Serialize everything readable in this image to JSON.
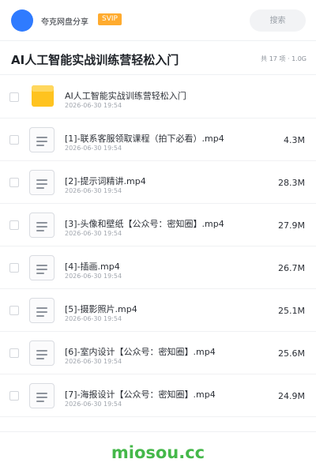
{
  "header": {
    "brand": "夸克网盘分享",
    "badge": "SVIP",
    "search_placeholder": "搜索"
  },
  "title_bar": {
    "title": "AI人工智能实战训练营轻松入门",
    "summary": "共 17 项 · 1.0G"
  },
  "files": [
    {
      "name": "AI人工智能实战训练营轻松入门",
      "date": "2026-06-30 19:54",
      "size": "",
      "type": "folder"
    },
    {
      "name": "[1]-联系客服领取课程（拍下必看）.mp4",
      "date": "2026-06-30 19:54",
      "size": "4.3M",
      "type": "file"
    },
    {
      "name": "[2]-提示词精讲.mp4",
      "date": "2026-06-30 19:54",
      "size": "28.3M",
      "type": "file"
    },
    {
      "name": "[3]-头像和壁纸【公众号：密知圈】.mp4",
      "date": "2026-06-30 19:54",
      "size": "27.9M",
      "type": "file"
    },
    {
      "name": "[4]-插画.mp4",
      "date": "2026-06-30 19:54",
      "size": "26.7M",
      "type": "file"
    },
    {
      "name": "[5]-摄影照片.mp4",
      "date": "2026-06-30 19:54",
      "size": "25.1M",
      "type": "file"
    },
    {
      "name": "[6]-室内设计【公众号：密知圈】.mp4",
      "date": "2026-06-30 19:54",
      "size": "25.6M",
      "type": "file"
    },
    {
      "name": "[7]-海报设计【公众号：密知圈】.mp4",
      "date": "2026-06-30 19:54",
      "size": "24.9M",
      "type": "file"
    }
  ],
  "footer": {
    "watermark": "miosou.cc"
  },
  "colors": {
    "accent": "#2f7bff",
    "badge": "#ffab2e",
    "folder": "#ffc31f",
    "watermark": "#45b84a"
  }
}
